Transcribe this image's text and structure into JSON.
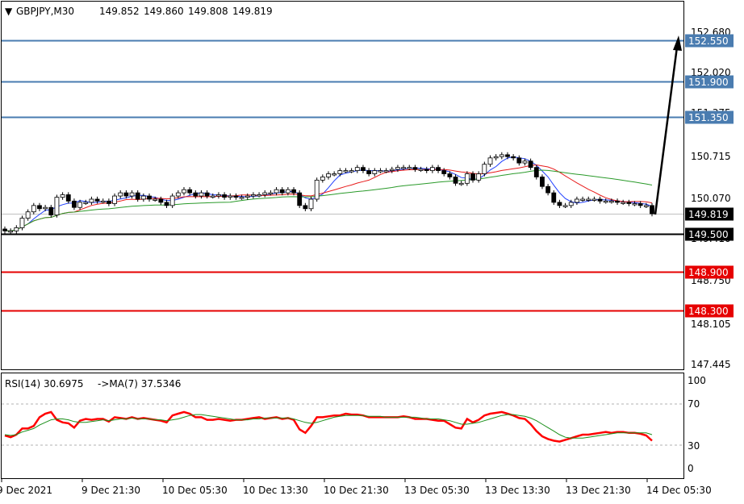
{
  "header": {
    "symbol": "GBPJPY,M30",
    "open": "149.852",
    "high": "149.860",
    "low": "149.808",
    "close": "149.819"
  },
  "rsi_header": {
    "label": "RSI(14) 30.6975",
    "ma_label": "->MA(7) 37.5346"
  },
  "price_ticks": [
    "152.680",
    "152.020",
    "151.375",
    "150.715",
    "150.070",
    "149.410",
    "148.750",
    "148.105",
    "147.445"
  ],
  "rsi_ticks": [
    "100",
    "70",
    "30",
    "0"
  ],
  "time_ticks": [
    "9 Dec 2021",
    "9 Dec 21:30",
    "10 Dec 05:30",
    "10 Dec 13:30",
    "10 Dec 21:30",
    "13 Dec 05:30",
    "13 Dec 13:30",
    "13 Dec 21:30",
    "14 Dec 05:30"
  ],
  "levels": [
    {
      "label": "152.550",
      "value": 152.55,
      "color": "#4a7cb0",
      "text_color": "#ffffff"
    },
    {
      "label": "151.900",
      "value": 151.9,
      "color": "#4a7cb0",
      "text_color": "#ffffff"
    },
    {
      "label": "151.350",
      "value": 151.35,
      "color": "#4a7cb0",
      "text_color": "#ffffff"
    },
    {
      "label": "149.819",
      "value": 149.819,
      "color": "#000000",
      "text_color": "#ffffff"
    },
    {
      "label": "149.500",
      "value": 149.5,
      "color": "#000000",
      "text_color": "#ffffff"
    },
    {
      "label": "148.900",
      "value": 148.9,
      "color": "#e60000",
      "text_color": "#ffffff"
    },
    {
      "label": "148.300",
      "value": 148.3,
      "color": "#e60000",
      "text_color": "#ffffff"
    }
  ],
  "colors": {
    "candle": "#000000",
    "ma_fast": "#1f3fff",
    "ma_mid": "#e81b1b",
    "ma_slow": "#2a9a2a",
    "rsi": "#ff0000",
    "rsi_ma": "#1a8f1a",
    "resistance": "#4a7cb0",
    "support": "#e60000",
    "arrow": "#000000"
  },
  "chart_data": {
    "type": "candlestick",
    "symbol": "GBPJPY",
    "timeframe": "M30",
    "ylim": [
      147.445,
      152.68
    ],
    "rsi_ylim": [
      0,
      100
    ],
    "close": [
      149.55,
      149.55,
      149.6,
      149.75,
      149.85,
      149.95,
      149.9,
      149.92,
      149.8,
      150.08,
      150.12,
      150.02,
      149.92,
      150.0,
      150.0,
      150.05,
      150.02,
      150.02,
      149.98,
      150.1,
      150.15,
      150.1,
      150.15,
      150.05,
      150.1,
      150.05,
      150.05,
      150.0,
      149.95,
      150.1,
      150.15,
      150.2,
      150.15,
      150.1,
      150.15,
      150.1,
      150.1,
      150.12,
      150.08,
      150.1,
      150.08,
      150.08,
      150.1,
      150.12,
      150.12,
      150.15,
      150.15,
      150.2,
      150.15,
      150.2,
      150.15,
      149.95,
      149.9,
      150.05,
      150.35,
      150.4,
      150.45,
      150.45,
      150.5,
      150.5,
      150.5,
      150.55,
      150.5,
      150.45,
      150.5,
      150.5,
      150.5,
      150.52,
      150.55,
      150.55,
      150.55,
      150.52,
      150.52,
      150.5,
      150.55,
      150.5,
      150.45,
      150.4,
      150.3,
      150.3,
      150.45,
      150.35,
      150.45,
      150.6,
      150.7,
      150.72,
      150.75,
      150.72,
      150.7,
      150.62,
      150.65,
      150.55,
      150.4,
      150.25,
      150.15,
      150.0,
      149.95,
      149.95,
      150.0,
      150.05,
      150.05,
      150.05,
      150.05,
      150.02,
      150.02,
      150.02,
      150.0,
      150.0,
      149.98,
      149.98,
      149.95,
      149.95,
      149.82
    ],
    "series": [
      {
        "name": "RSI(14)",
        "values": [
          37,
          35,
          38,
          45,
          45,
          48,
          58,
          62,
          64,
          55,
          52,
          51,
          46,
          54,
          56,
          55,
          56,
          56,
          53,
          58,
          57,
          56,
          58,
          56,
          57,
          56,
          55,
          54,
          52,
          60,
          62,
          64,
          62,
          58,
          58,
          55,
          55,
          56,
          55,
          54,
          55,
          55,
          56,
          57,
          58,
          56,
          57,
          58,
          56,
          57,
          55,
          44,
          40,
          48,
          58,
          58,
          59,
          60,
          60,
          62,
          61,
          61,
          60,
          58,
          58,
          58,
          58,
          58,
          58,
          59,
          58,
          56,
          56,
          56,
          55,
          54,
          54,
          50,
          46,
          45,
          56,
          52,
          55,
          60,
          62,
          63,
          64,
          62,
          60,
          57,
          56,
          50,
          42,
          36,
          33,
          31,
          30,
          32,
          34,
          36,
          38,
          38,
          39,
          40,
          41,
          40,
          41,
          41,
          40,
          40,
          39,
          37,
          31
        ]
      },
      {
        "name": "MA(7)",
        "values": [
          38,
          37,
          38,
          41,
          43,
          45,
          49,
          52,
          55,
          56,
          56,
          55,
          53,
          52,
          52,
          53,
          54,
          55,
          54,
          55,
          56,
          56,
          57,
          56,
          56,
          56,
          55,
          55,
          54,
          55,
          56,
          58,
          60,
          61,
          61,
          60,
          59,
          58,
          57,
          56,
          55,
          55,
          55,
          56,
          56,
          57,
          57,
          57,
          57,
          57,
          56,
          54,
          52,
          51,
          52,
          54,
          56,
          58,
          59,
          60,
          60,
          60,
          60,
          59,
          59,
          59,
          58,
          58,
          58,
          58,
          58,
          58,
          57,
          56,
          56,
          56,
          55,
          54,
          52,
          50,
          50,
          51,
          52,
          54,
          56,
          58,
          60,
          61,
          61,
          60,
          59,
          57,
          54,
          50,
          46,
          42,
          38,
          35,
          34,
          34,
          34,
          35,
          36,
          37,
          38,
          39,
          40,
          40,
          40,
          40,
          40,
          40,
          38
        ]
      }
    ]
  }
}
